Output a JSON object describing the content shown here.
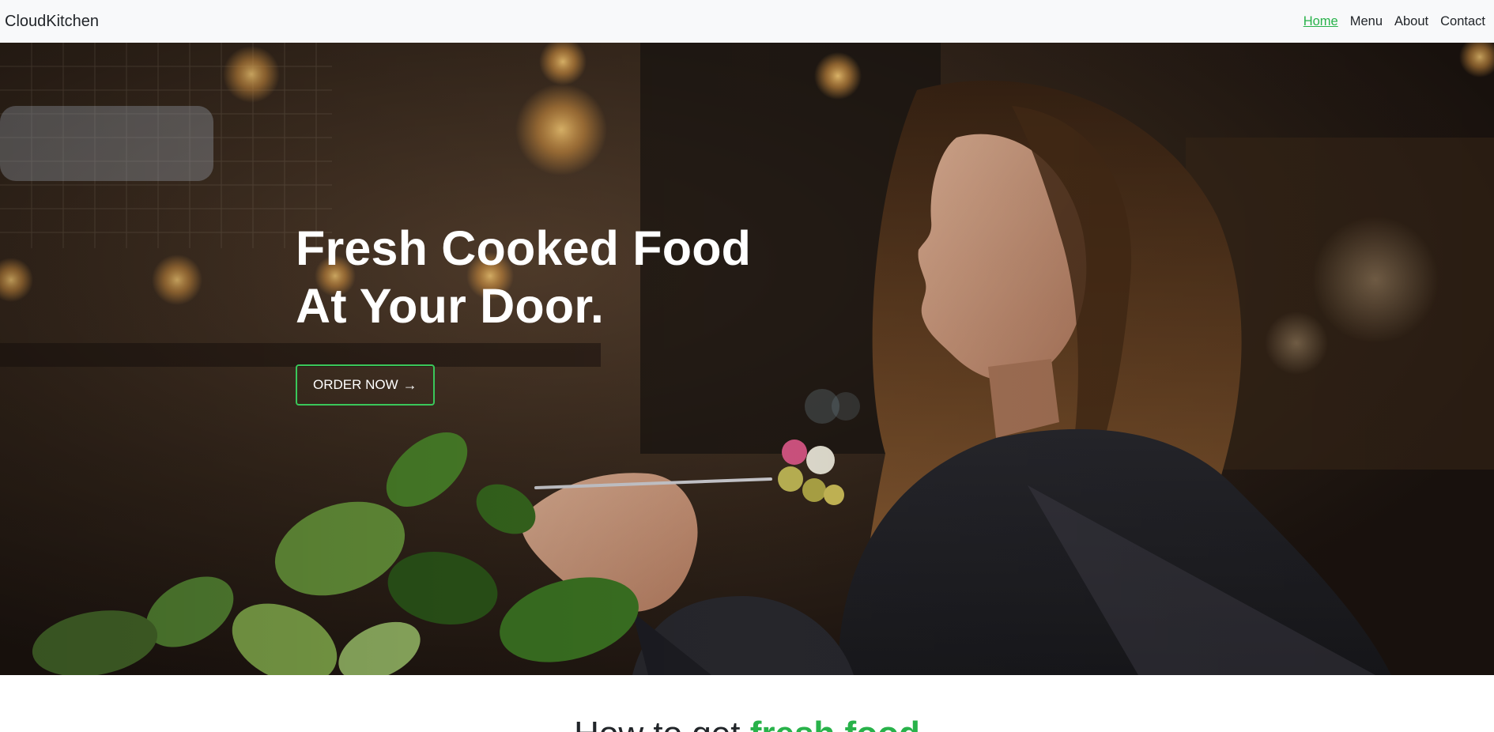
{
  "navbar": {
    "brand": "CloudKitchen",
    "links": [
      {
        "label": "Home",
        "active": true
      },
      {
        "label": "Menu",
        "active": false
      },
      {
        "label": "About",
        "active": false
      },
      {
        "label": "Contact",
        "active": false
      }
    ]
  },
  "hero": {
    "title_line1": "Fresh Cooked Food",
    "title_line2": "At Your Door.",
    "cta_label": "ORDER NOW",
    "cta_icon": "→",
    "image": "woman-eating-pasta-photo"
  },
  "how_section": {
    "title_prefix": "How to get ",
    "title_accent": "fresh food"
  },
  "colors": {
    "accent": "#28b24a",
    "navbar_bg": "#f8f9fa",
    "cta_border": "#3ac75a"
  }
}
